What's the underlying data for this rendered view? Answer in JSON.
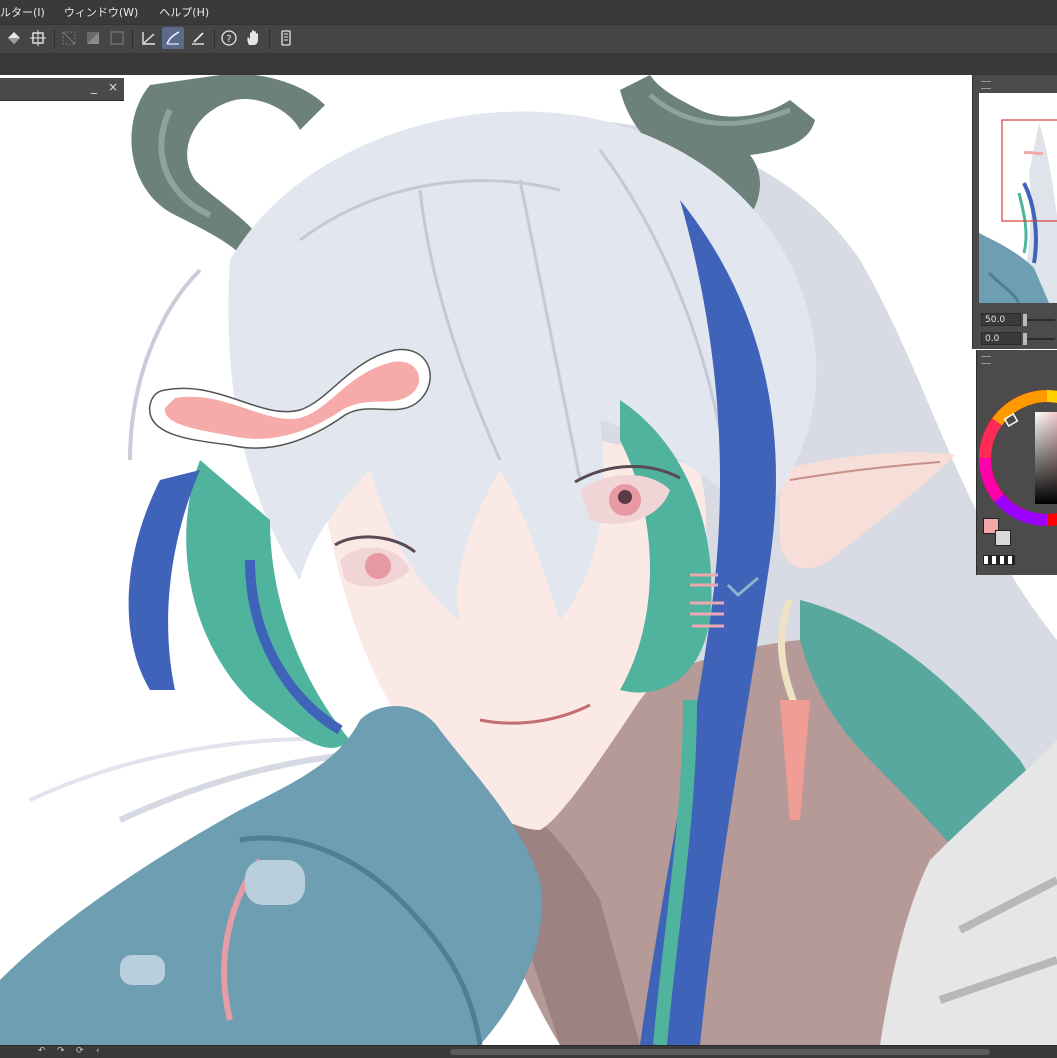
{
  "menubar": {
    "items": [
      "ルター(I)",
      "ウィンドウ(W)",
      "ヘルプ(H)"
    ]
  },
  "toolbar": {
    "tools": [
      "fill-tool-icon",
      "transform-tool-icon",
      "selection-off-icon",
      "selection-invert-icon",
      "selection-clear-icon",
      "ruler-icon",
      "stroke-correct-icon",
      "pen-pressure-icon",
      "help-icon",
      "hand-tool-icon",
      "device-icon"
    ],
    "active_tool": "stroke-correct-icon"
  },
  "left_panel": {
    "minimize_glyph": "_",
    "close_glyph": "×"
  },
  "navigator": {
    "zoom_value": "50.0",
    "rotate_value": "0.0"
  },
  "color_panel": {
    "foreground_color": "#f3a7a7",
    "background_color": "#d9d9d9"
  },
  "canvas": {
    "artwork": "character illustration"
  },
  "bottom_bar": {
    "icons": [
      "undo-icon",
      "redo-icon",
      "rotate-icon",
      "prev-icon"
    ]
  }
}
